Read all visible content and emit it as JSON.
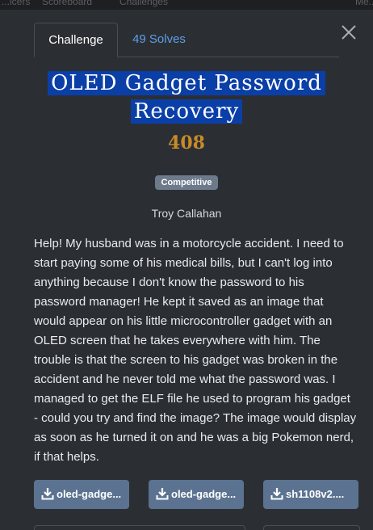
{
  "backdrop": {
    "nav_items": [
      "...icers",
      "Scoreboard",
      "Challenges",
      "Me..."
    ]
  },
  "modal": {
    "tabs": [
      {
        "label": "Challenge",
        "active": true
      },
      {
        "label": "49 Solves",
        "active": false
      }
    ],
    "close_icon": "close-icon",
    "title_line1": "OLED Gadget Password",
    "title_line2": "Recovery",
    "points": "408",
    "category_badge": "Competitive",
    "author": "Troy Callahan",
    "description": "Help! My husband was in a motorcycle accident. I need to start paying some of his medical bills, but I can't log into anything because I don't know the password to his password manager! He kept it saved as an image that would appear on his little microcontroller gadget with an OLED screen that he takes everywhere with him. The trouble is that the screen to his gadget was broken in the accident and he never told me what the password was. I managed to get the ELF file he used to program his gadget - could you try and find the image? The image would display as soon as he turned it on and he was a big Pokemon nerd, if that helps.",
    "files": [
      {
        "label": "oled-gadge...",
        "icon": "download-icon"
      },
      {
        "label": "oled-gadge...",
        "icon": "download-icon"
      },
      {
        "label": "sh1108v2....",
        "icon": "download-icon"
      }
    ]
  },
  "colors": {
    "modal_bg": "#2b2f33",
    "title_highlight": "#0b3fa8",
    "points": "#c88a2a",
    "badge": "#6c7a8c",
    "file_button": "#5b7391",
    "tab_link": "#5d9ee8"
  }
}
